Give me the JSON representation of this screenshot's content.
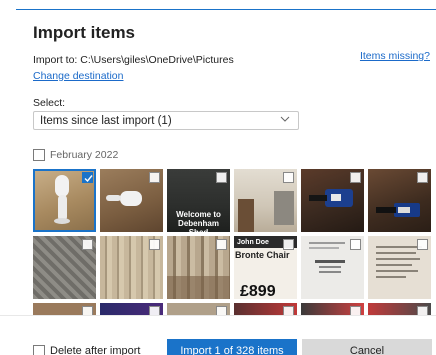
{
  "dialog": {
    "title": "Import items",
    "import_to_label": "Import to: C:\\Users\\giles\\OneDrive\\Pictures",
    "change_destination": "Change destination",
    "items_missing": "Items missing?",
    "select_label": "Select:",
    "select_value": "Items since last import (1)"
  },
  "group": {
    "label": "February 2022",
    "checked": false
  },
  "tiles": [
    {
      "name": "photo-white-hook",
      "selected": true
    },
    {
      "name": "photo-white-plug",
      "selected": false
    },
    {
      "name": "photo-welcome-sign",
      "selected": false,
      "text": "Welcome to Debenham Shed"
    },
    {
      "name": "photo-room-wall",
      "selected": false
    },
    {
      "name": "photo-cable-connector-1",
      "selected": false
    },
    {
      "name": "photo-cable-connector-2",
      "selected": false
    },
    {
      "name": "photo-armchair-1",
      "selected": false
    },
    {
      "name": "photo-fabric-cushion",
      "selected": false
    },
    {
      "name": "photo-chair-fabric",
      "selected": false
    },
    {
      "name": "photo-price-tag",
      "selected": false,
      "text_top": "John Doe",
      "text_mid": "Bronte Chair",
      "price": "£899"
    },
    {
      "name": "photo-product-card",
      "selected": false
    },
    {
      "name": "photo-document",
      "selected": false
    },
    {
      "name": "photo-row3-1",
      "selected": false
    },
    {
      "name": "photo-row3-2",
      "selected": false
    },
    {
      "name": "photo-row3-3",
      "selected": false
    },
    {
      "name": "photo-row3-4",
      "selected": false
    },
    {
      "name": "photo-row3-5",
      "selected": false
    },
    {
      "name": "photo-row3-6",
      "selected": false
    }
  ],
  "footer": {
    "delete_after_import": "Delete after import",
    "import_button": "Import 1 of 328 items",
    "cancel_button": "Cancel"
  },
  "colors": {
    "accent": "#1a73c9",
    "link": "#1b6ac9",
    "cancel_bg": "#d9d9d9"
  }
}
